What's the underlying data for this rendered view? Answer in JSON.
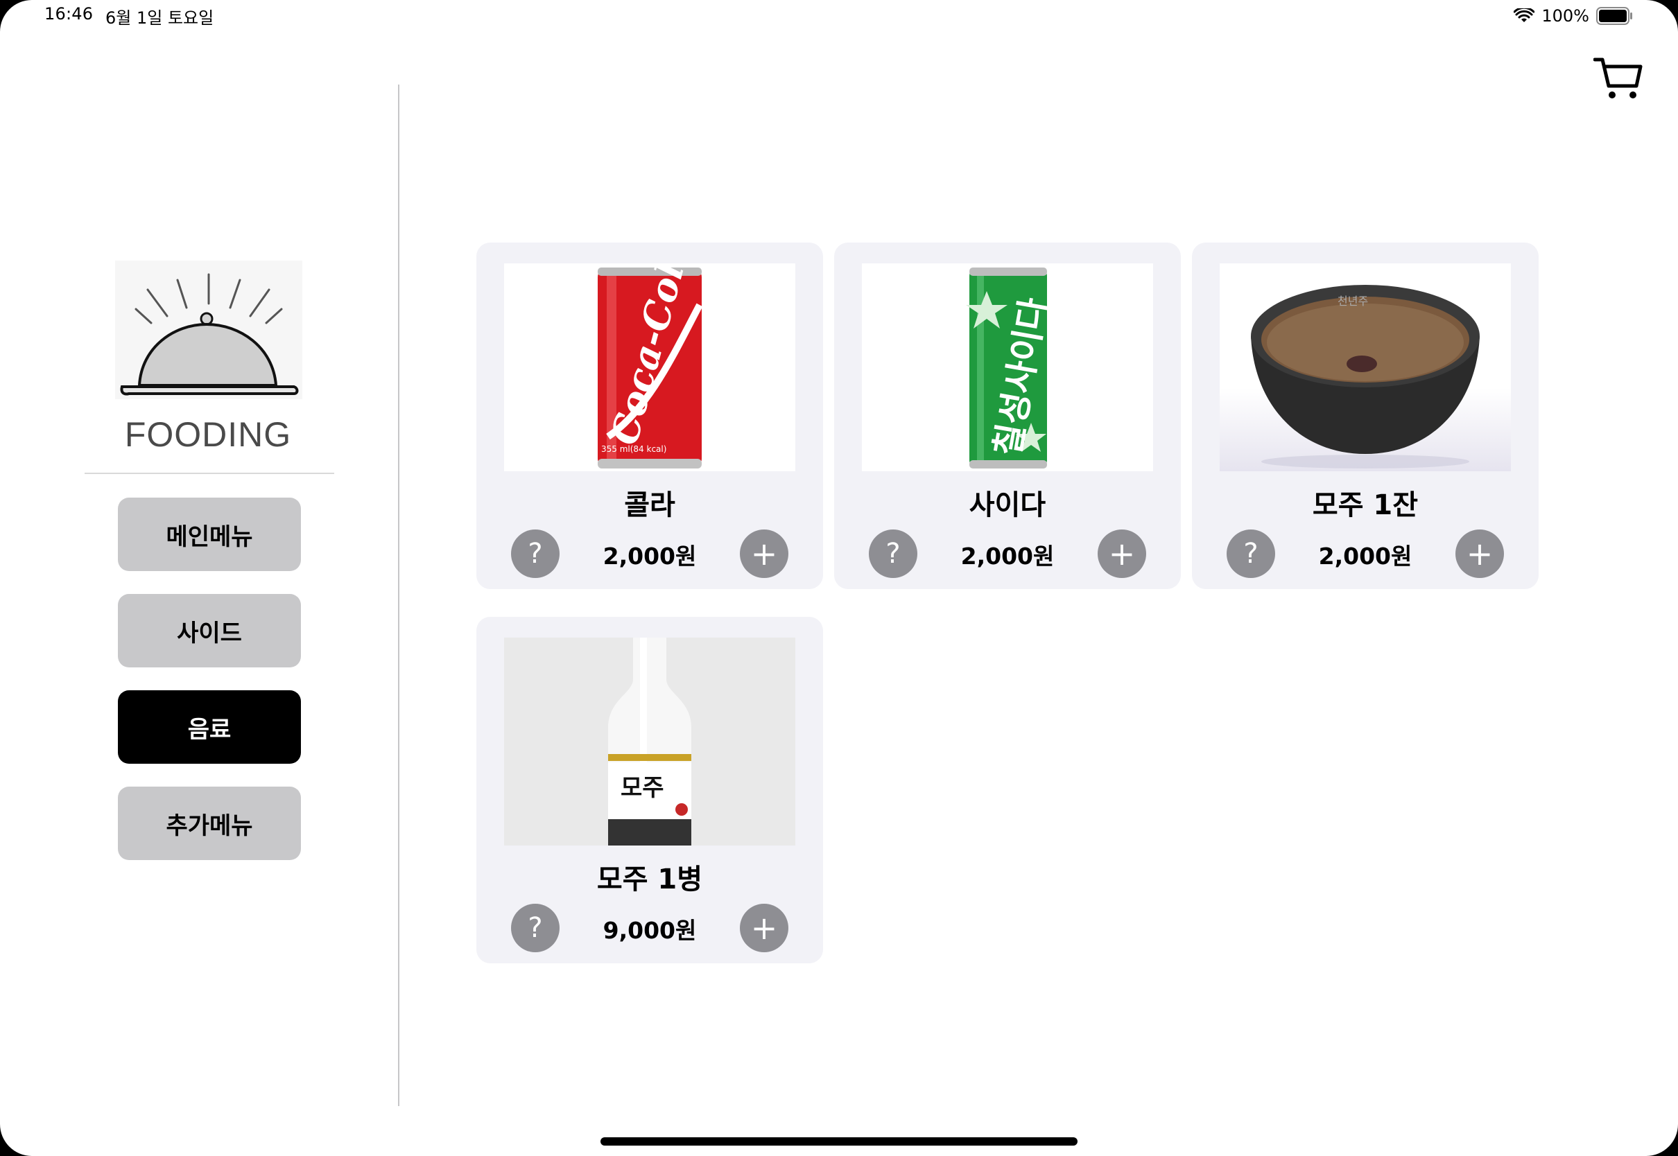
{
  "status_bar": {
    "time": "16:46",
    "date": "6월 1일 토요일",
    "battery": "100%"
  },
  "brand": {
    "name": "FOODING"
  },
  "categories": [
    {
      "label": "메인메뉴",
      "active": false
    },
    {
      "label": "사이드",
      "active": false
    },
    {
      "label": "음료",
      "active": true
    },
    {
      "label": "추가메뉴",
      "active": false
    }
  ],
  "products": [
    {
      "name": "콜라",
      "price": "2,000원",
      "image": "coca-cola-can"
    },
    {
      "name": "사이다",
      "price": "2,000원",
      "image": "chilsung-cider-can"
    },
    {
      "name": "모주 1잔",
      "price": "2,000원",
      "image": "moju-bowl"
    },
    {
      "name": "모주 1병",
      "price": "9,000원",
      "image": "moju-bottle"
    }
  ],
  "controls": {
    "info_glyph": "?",
    "add_glyph": "+"
  },
  "colors": {
    "card_bg": "#f2f2f7",
    "button_gray": "#8e8e93",
    "category_inactive": "#c8c8ca",
    "category_active": "#000000",
    "coke_red": "#d71920",
    "cider_green": "#1f9a3e"
  }
}
